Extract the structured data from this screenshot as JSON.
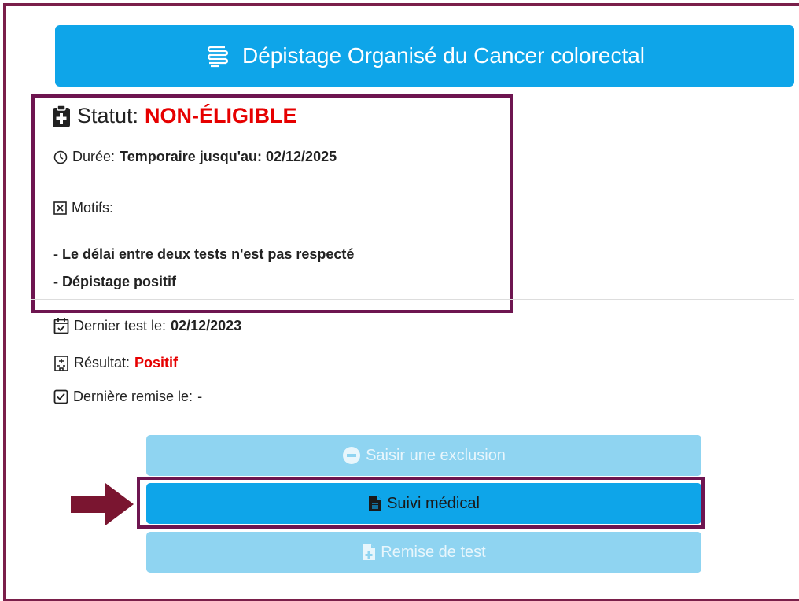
{
  "header": {
    "title": "Dépistage Organisé du Cancer colorectal",
    "icon": "intestine-icon"
  },
  "status": {
    "label": "Statut:",
    "value": "NON-ÉLIGIBLE",
    "duration_label": "Durée:",
    "duration_value": "Temporaire jusqu'au: 02/12/2025",
    "reasons_label": "Motifs:",
    "reasons": [
      "- Le délai entre deux tests n'est pas respecté",
      "- Dépistage positif"
    ]
  },
  "details": {
    "last_test_label": "Dernier test le:",
    "last_test_value": "02/12/2023",
    "result_label": "Résultat:",
    "result_value": "Positif",
    "last_handover_label": "Dernière remise le:",
    "last_handover_value": "-"
  },
  "buttons": {
    "exclusion": "Saisir une exclusion",
    "follow_up": "Suivi médical",
    "handover": "Remise de test"
  },
  "colors": {
    "accent": "#0ea5e9",
    "highlight": "#6e1550",
    "alert": "#e60000",
    "arrow": "#7a1530"
  }
}
